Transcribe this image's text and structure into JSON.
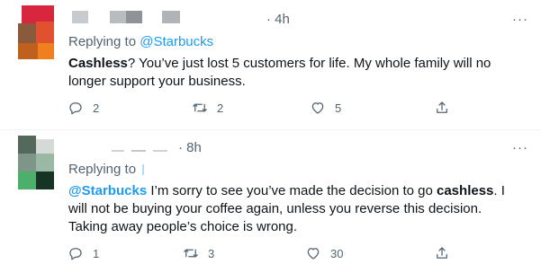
{
  "tweets": [
    {
      "time": "· 4h",
      "more": "···",
      "replying_to_label": "Replying to",
      "replying_to_handle": "@Starbucks",
      "body_lead_bold": "Cashless",
      "body_rest": "? You’ve just lost 5 customers for life. My whole family will no longer support your business.",
      "replies": "2",
      "retweets": "2",
      "likes": "5"
    },
    {
      "time": "· 8h",
      "more": "···",
      "replying_to_label": "Replying to",
      "body_mention": "@Starbucks",
      "body_part1": " I’m sorry to see you’ve made the decision to go ",
      "body_bold": "cashless",
      "body_part2": ". I will not be buying your coffee again, unless you reverse this decision. Taking away people’s choice is wrong.",
      "replies": "1",
      "retweets": "3",
      "likes": "30"
    }
  ],
  "colors": {
    "accent": "#1d9bf0",
    "muted": "#536471",
    "text": "#0f1419"
  },
  "icons": [
    "reply-icon",
    "retweet-icon",
    "like-icon",
    "share-icon",
    "more-icon"
  ]
}
